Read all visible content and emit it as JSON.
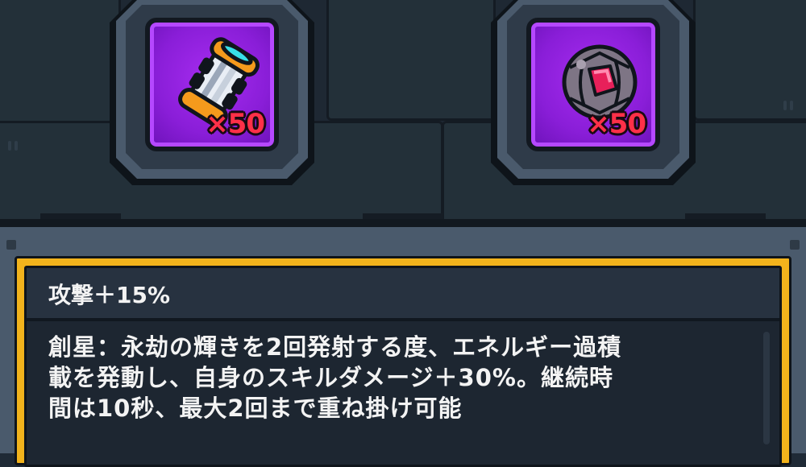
{
  "items": [
    {
      "name": "energy-canister",
      "icon": "canister-icon",
      "quantity": "×50"
    },
    {
      "name": "gem-sphere",
      "icon": "gem-sphere-icon",
      "quantity": "×50"
    }
  ],
  "panel": {
    "stat": "攻撃＋15%",
    "description_lines": [
      "創星：永劫の輝きを2回発射する度、エネルギー過積",
      "載を発動し、自身のスキルダメージ＋30%。継続時",
      "間は10秒、最大2回まで重ね掛け可能"
    ]
  },
  "colors": {
    "slot_purple": "#8a1ed8",
    "quantity_red": "#ff3048",
    "panel_gold": "#f2b31c",
    "panel_dark": "#1d2631"
  }
}
